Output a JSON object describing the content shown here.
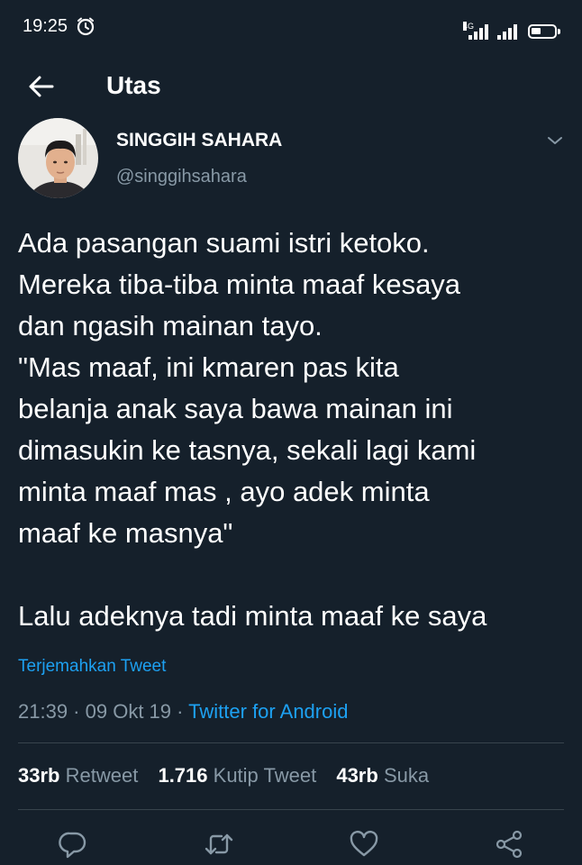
{
  "status_bar": {
    "time": "19:25",
    "network": "4G",
    "alarm_icon": "alarm-clock-icon",
    "battery_icon": "battery-icon"
  },
  "header": {
    "back_icon": "arrow-left-icon",
    "title": "Utas"
  },
  "tweet": {
    "author": {
      "name": "SINGGIH SAHARA",
      "handle": "@singgihsahara"
    },
    "text": "Ada pasangan suami istri ketoko.\nMereka tiba-tiba minta maaf kesaya\ndan ngasih mainan tayo.\n\"Mas maaf, ini kmaren pas kita\nbelanja anak saya bawa mainan ini\ndimasukin ke tasnya, sekali lagi kami\nminta maaf mas , ayo adek minta\nmaaf ke masnya\"\n\nLalu adeknya tadi minta maaf ke saya",
    "translate_label": "Terjemahkan Tweet",
    "time": "21:39",
    "separator": " · ",
    "date": "09 Okt 19",
    "source": "Twitter for Android",
    "stats": {
      "retweets_count": "33rb",
      "retweets_label": "Retweet",
      "quotes_count": "1.716",
      "quotes_label": "Kutip Tweet",
      "likes_count": "43rb",
      "likes_label": "Suka"
    }
  },
  "actions": [
    "reply-icon",
    "retweet-icon",
    "like-icon",
    "share-icon"
  ],
  "colors": {
    "background": "#15202b",
    "text_primary": "#ffffff",
    "text_secondary": "#8899a6",
    "accent": "#1da1f2",
    "divider": "#38444d"
  }
}
